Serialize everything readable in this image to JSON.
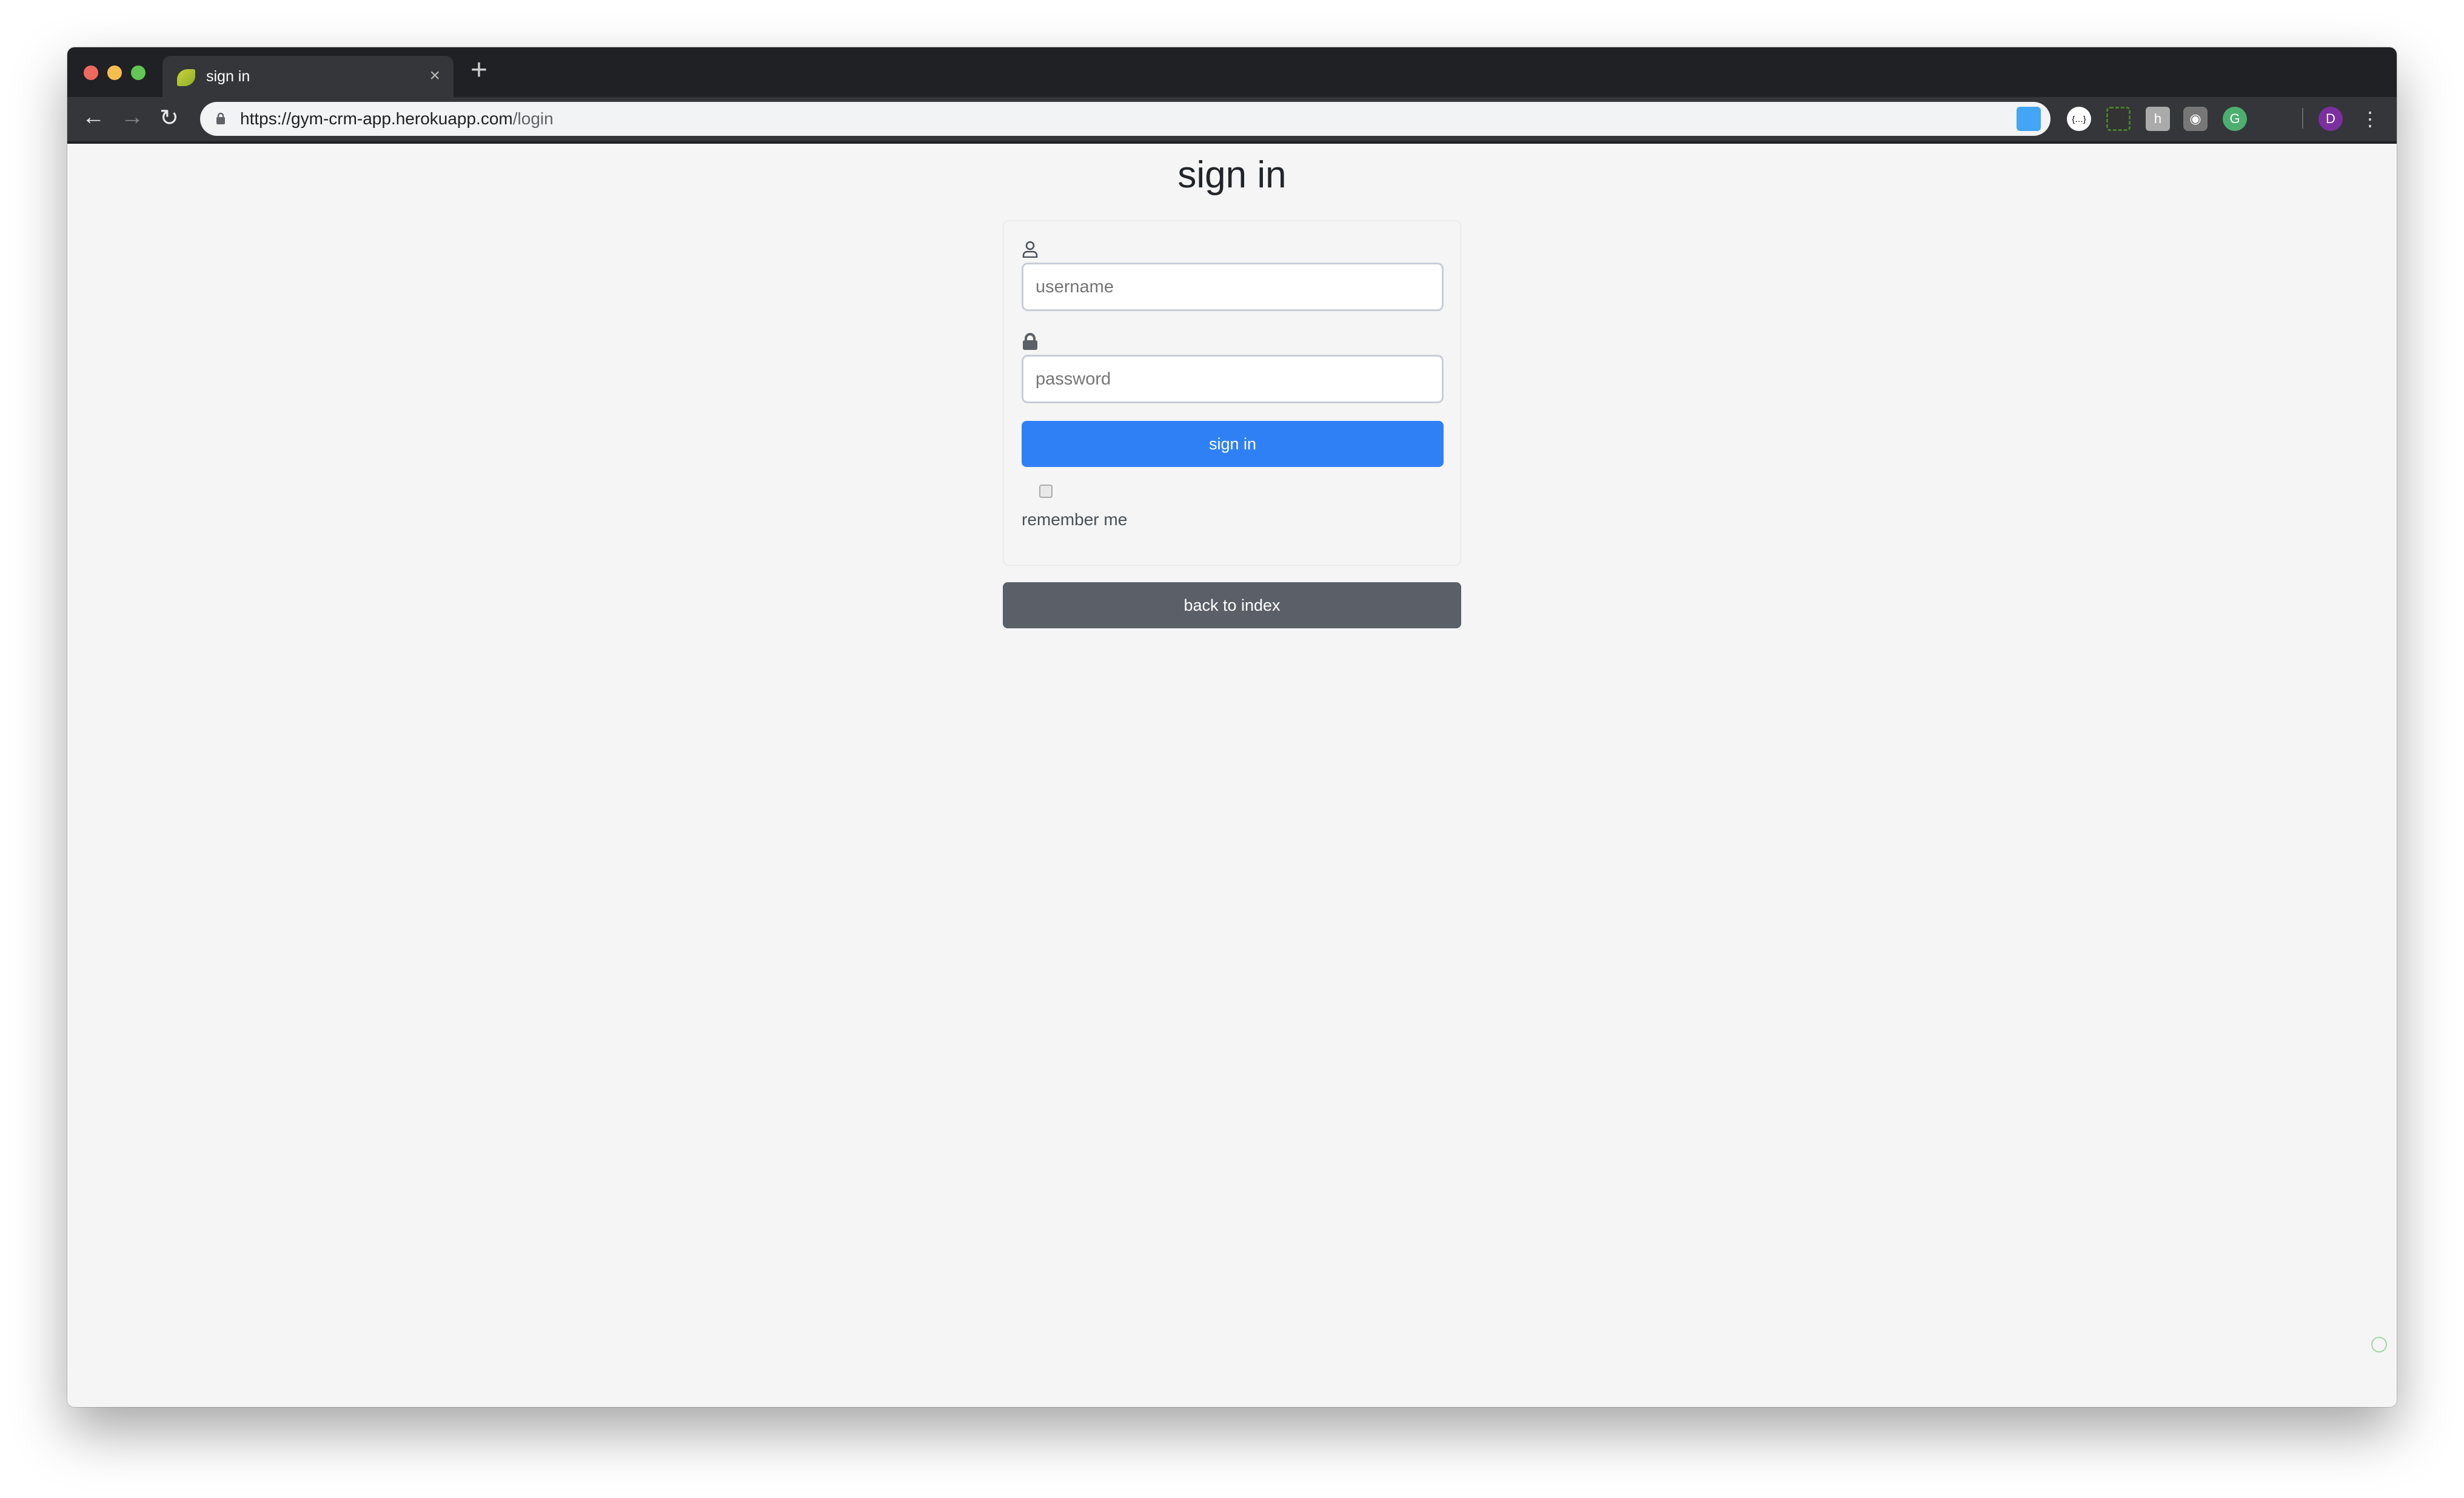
{
  "browser": {
    "tab_title": "sign in",
    "new_tab_label": "+",
    "close_tab_label": "×",
    "url_host": "https://gym-crm-app.herokuapp.com",
    "url_path": "/login",
    "profile_initial": "D",
    "extensions": [
      "folder-extension-icon",
      "json-viewer-icon",
      "screenshot-crop-icon",
      "honey-icon",
      "camera-icon",
      "grammarly-icon"
    ]
  },
  "page": {
    "title": "sign in",
    "username_placeholder": "username",
    "password_placeholder": "password",
    "sign_in_label": "sign in",
    "remember_label": "remember me",
    "remember_checked": false,
    "back_label": "back to index"
  },
  "colors": {
    "primary": "#3080f5",
    "secondary": "#5b6068",
    "background": "#f5f5f5"
  }
}
